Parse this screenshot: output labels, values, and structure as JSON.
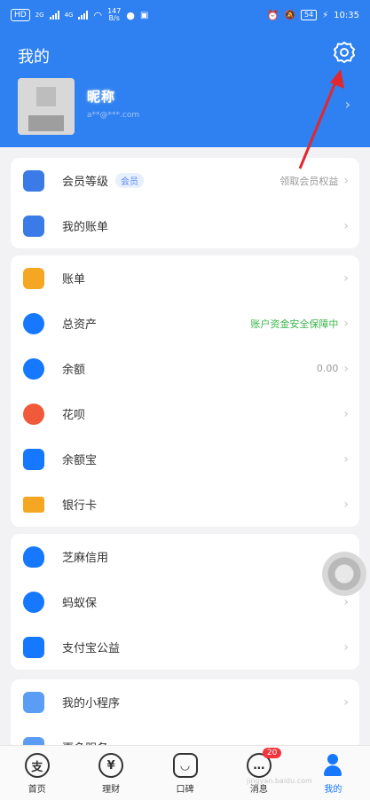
{
  "status_bar": {
    "left_chip": "HD",
    "net_a": "2G",
    "net_b": "4G",
    "speed": "147",
    "speed_unit": "B/s",
    "battery": "54",
    "time": "10:35"
  },
  "header": {
    "title": "我的",
    "profile_name": "昵称",
    "profile_sub": "a**@***.com",
    "settings_icon": "gear-icon"
  },
  "cards": [
    {
      "rows": [
        {
          "icon": "member-icon",
          "color": "#3b7be8",
          "label": "会员等级",
          "tag": "会员",
          "value": "领取会员权益"
        },
        {
          "icon": "account-icon",
          "color": "#3b7be8",
          "label": "我的账单",
          "value": ""
        }
      ]
    },
    {
      "rows": [
        {
          "icon": "bill-icon",
          "color": "#f5a623",
          "label": "账单",
          "value": ""
        },
        {
          "icon": "balance-icon",
          "color": "#1677ff",
          "label": "总资产",
          "value": "账户资金安全保障中",
          "value_green": true
        },
        {
          "icon": "yuebao-icon",
          "color": "#1677ff",
          "label": "余额",
          "value": "0.00"
        },
        {
          "icon": "huabei-icon",
          "color": "#f0593a",
          "label": "花呗",
          "value": ""
        },
        {
          "icon": "yuebao2-icon",
          "color": "#1677ff",
          "label": "余额宝",
          "value": ""
        },
        {
          "icon": "card-icon",
          "color": "#f5a623",
          "label": "银行卡",
          "value": ""
        }
      ]
    },
    {
      "rows": [
        {
          "icon": "insurance-icon",
          "color": "#1677ff",
          "label": "芝麻信用",
          "value": ""
        },
        {
          "icon": "security-icon",
          "color": "#1677ff",
          "label": "蚂蚁保",
          "value": ""
        },
        {
          "icon": "charity-icon",
          "color": "#1677ff",
          "label": "支付宝公益",
          "value": ""
        }
      ]
    },
    {
      "rows": [
        {
          "icon": "miniprogram-icon",
          "color": "#5b9df5",
          "label": "我的小程序",
          "value": ""
        },
        {
          "icon": "more-icon",
          "color": "#5b9df5",
          "label": "更多服务",
          "value": ""
        }
      ]
    }
  ],
  "bottom_nav": [
    {
      "icon": "支",
      "label": "首页",
      "name": "home"
    },
    {
      "icon": "¥",
      "label": "理财",
      "name": "wealth"
    },
    {
      "icon": "◡",
      "label": "口碑",
      "name": "koubei"
    },
    {
      "icon": "…",
      "label": "消息",
      "name": "messages",
      "badge": "20"
    },
    {
      "icon": "",
      "label": "我的",
      "name": "mine",
      "active": true
    }
  ],
  "watermark": "jingyan.baidu.com"
}
